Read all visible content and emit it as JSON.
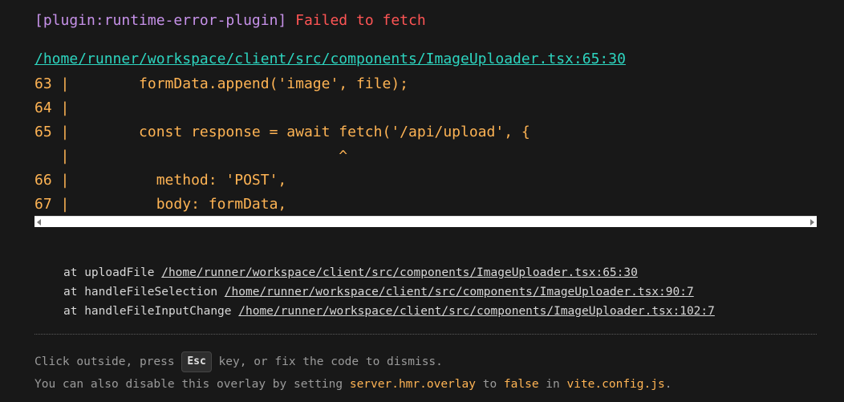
{
  "message": {
    "plugin": "[plugin:runtime-error-plugin]",
    "text": "Failed to fetch"
  },
  "file": {
    "link": "/home/runner/workspace/client/src/components/ImageUploader.tsx:65:30"
  },
  "frame": {
    "lines": [
      "63 |        formData.append('image', file);",
      "64 |",
      "65 |        const response = await fetch('/api/upload', {",
      "   |                               ^",
      "66 |          method: 'POST',",
      "67 |          body: formData,"
    ]
  },
  "stack": {
    "frames": [
      {
        "prefix": "at uploadFile ",
        "link": "/home/runner/workspace/client/src/components/ImageUploader.tsx:65:30"
      },
      {
        "prefix": "at handleFileSelection ",
        "link": "/home/runner/workspace/client/src/components/ImageUploader.tsx:90:7"
      },
      {
        "prefix": "at handleFileInputChange ",
        "link": "/home/runner/workspace/client/src/components/ImageUploader.tsx:102:7"
      }
    ]
  },
  "tip": {
    "line1_before": "Click outside, press ",
    "esc_key": "Esc",
    "line1_after": " key, or fix the code to dismiss.",
    "line2_a": "You can also disable this overlay by setting ",
    "line2_code1": "server.hmr.overlay",
    "line2_b": " to ",
    "line2_code2": "false",
    "line2_c": " in ",
    "line2_code3": "vite.config.js",
    "line2_d": "."
  },
  "colors": {
    "background": "#181818",
    "plugin": "#c792ea",
    "error": "#ff5555",
    "file_link": "#2dd4bf",
    "frame_code": "#ffb454",
    "dim_text": "#9a9a9a"
  },
  "icons": {
    "scroll_left": "scroll-left-arrow-icon",
    "scroll_right": "scroll-right-arrow-icon"
  }
}
